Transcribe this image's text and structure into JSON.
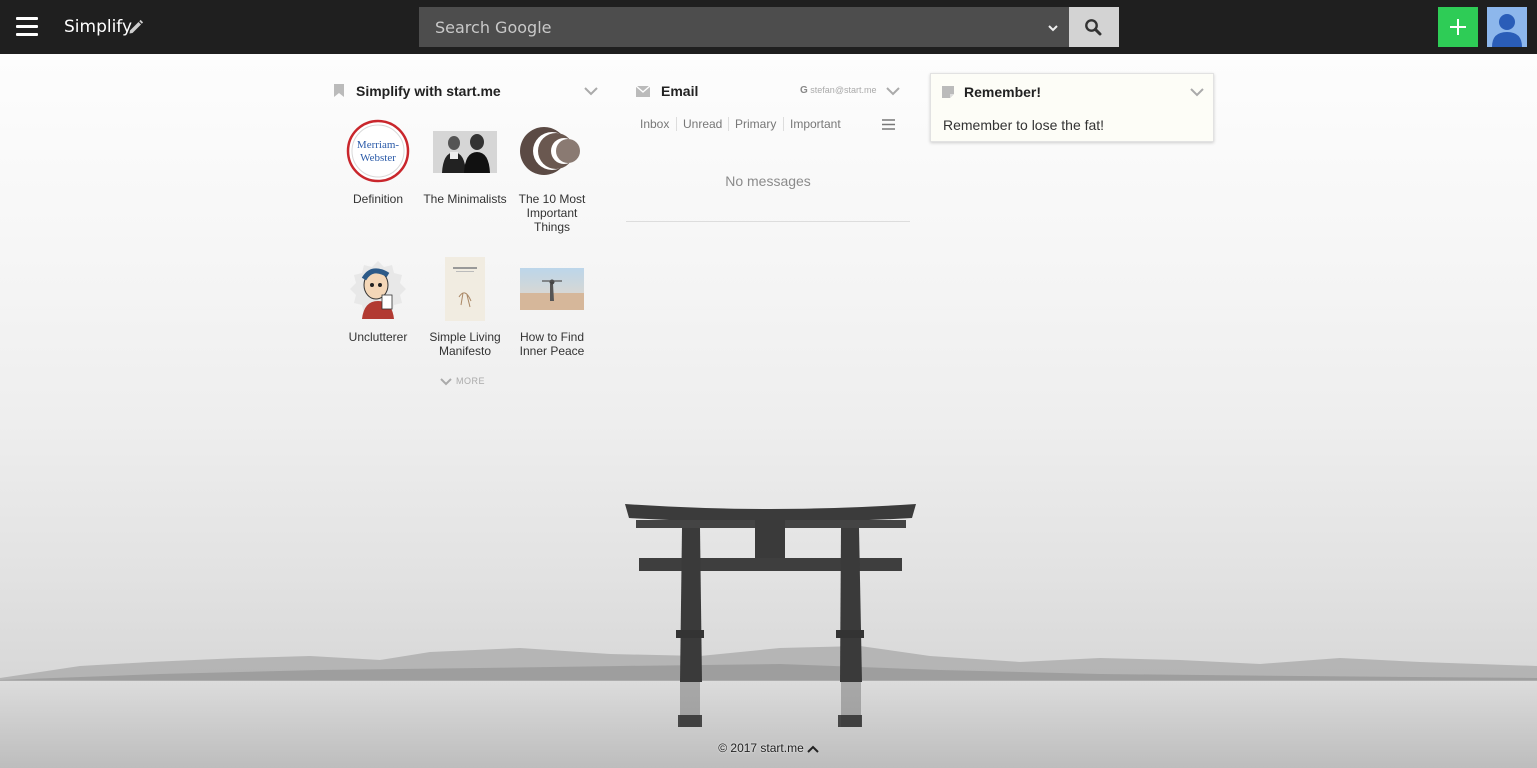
{
  "header": {
    "page_name": "Simplify",
    "search_placeholder": "Search Google"
  },
  "icons": {
    "menu": "hamburger-menu-icon",
    "edit": "pencil-icon",
    "engine": "chevron-down-icon",
    "search": "magnifier-icon",
    "add": "plus-icon",
    "profile": "user-avatar-icon"
  },
  "colors": {
    "topbar": "#1f1f1f",
    "search_field": "#4d4d4d",
    "search_button": "#d3d3d3",
    "add_button": "#2ecc56",
    "avatar": "#8db7ec",
    "note_background": "#fdfdf7"
  },
  "bookmarks": {
    "title": "Simplify with start.me",
    "items": [
      {
        "label": "Definition",
        "thumb_text": "Merriam-Webster"
      },
      {
        "label": "The Minimalists"
      },
      {
        "label": "The 10 Most Important Things"
      },
      {
        "label": "Unclutterer"
      },
      {
        "label": "Simple Living Manifesto"
      },
      {
        "label": "How to Find Inner Peace"
      }
    ],
    "more_label": "MORE"
  },
  "email": {
    "title": "Email",
    "account_mark": "G",
    "account": "stefan@start.me",
    "tabs": [
      "Inbox",
      "Unread",
      "Primary",
      "Important"
    ],
    "empty_text": "No messages"
  },
  "note": {
    "title": "Remember!",
    "text": "Remember to lose the fat!"
  },
  "footer": {
    "text": "© 2017 start.me"
  }
}
